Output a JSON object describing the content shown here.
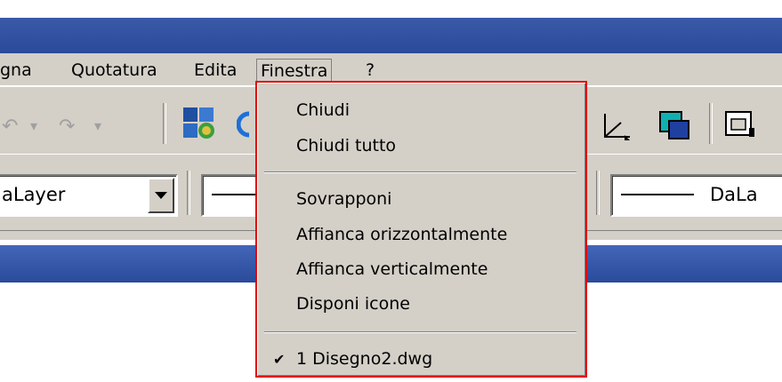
{
  "menubar": {
    "items": [
      "gna",
      "Quotatura",
      "Edita",
      "Finestra",
      "?"
    ]
  },
  "toolbar1": {
    "undo_symbol": "↶",
    "redo_symbol": "↷",
    "dropdown_arrow": "▾"
  },
  "toolbar2": {
    "layer_combo_value": "aLayer",
    "linetype_combo_value": "DaLa"
  },
  "finestra_menu": {
    "items": [
      {
        "label": "Chiudi"
      },
      {
        "label": "Chiudi tutto"
      },
      {
        "label": "Sovrapponi"
      },
      {
        "label": "Affianca orizzontalmente"
      },
      {
        "label": "Affianca verticalmente"
      },
      {
        "label": "Disponi icone"
      },
      {
        "label": "1 Disegno2.dwg",
        "checked": true
      }
    ],
    "check_mark": "✔"
  },
  "colors": {
    "titlebar": "#2b4a9a",
    "menu_bg": "#d4d0c8",
    "highlight_border": "#e00000"
  }
}
